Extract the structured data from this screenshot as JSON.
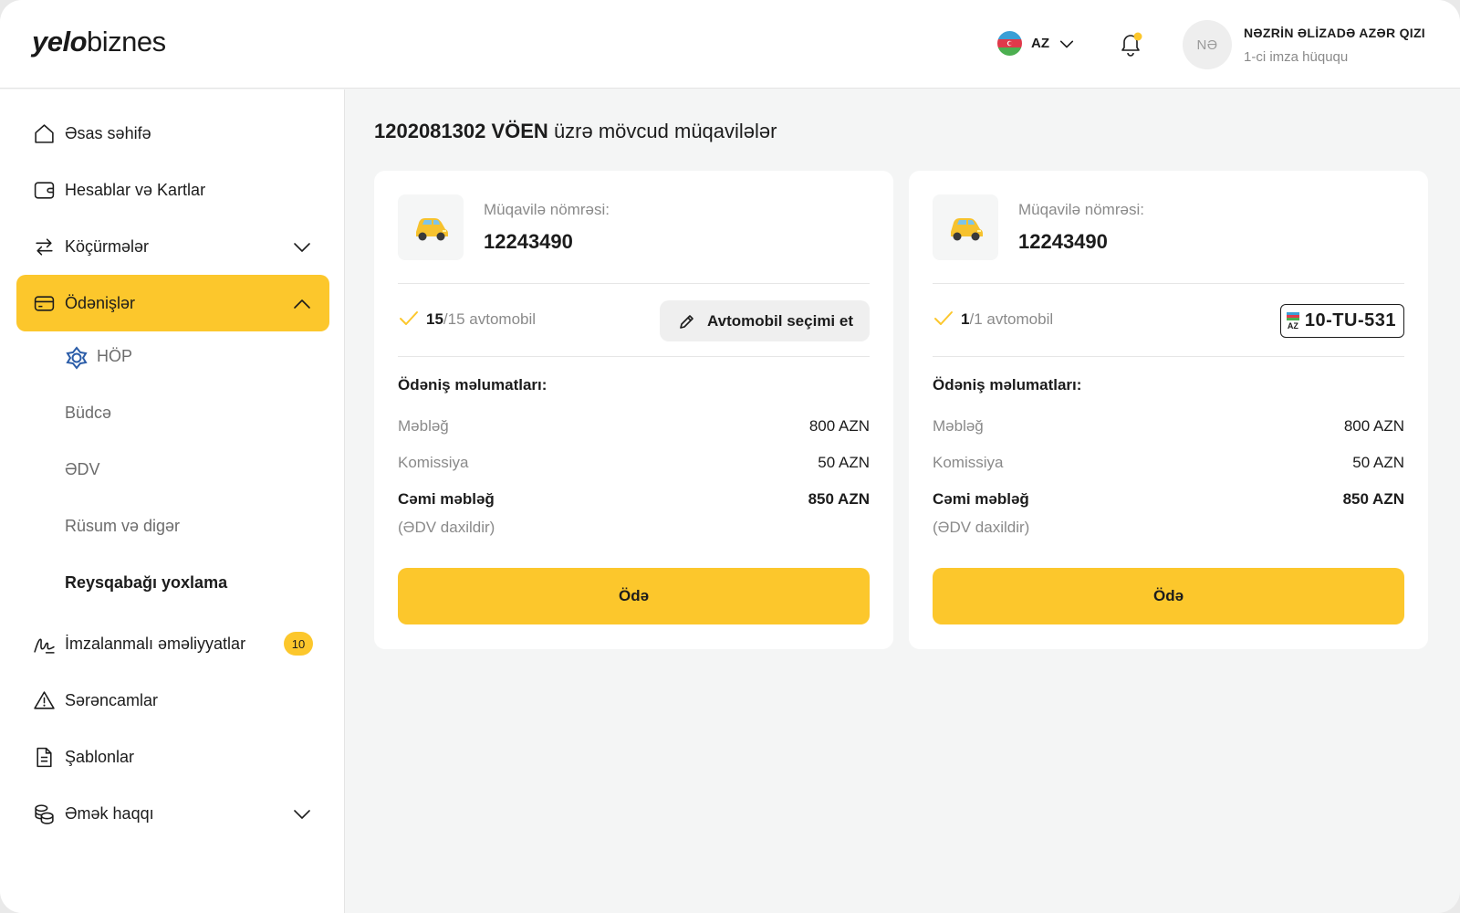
{
  "header": {
    "logo_bold": "yelo",
    "logo_rest": "biznes",
    "language": "AZ",
    "user_initials": "NƏ",
    "user_name": "NƏZRİN ƏLİZADƏ AZƏR QIZI",
    "user_role": "1-ci imza hüququ"
  },
  "sidebar": {
    "items": [
      {
        "label": "Əsas səhifə",
        "icon": "home-icon"
      },
      {
        "label": "Hesablar və Kartlar",
        "icon": "wallet-icon"
      },
      {
        "label": "Köçürmələr",
        "icon": "transfer-icon"
      },
      {
        "label": "Ödənişlər",
        "icon": "card-icon"
      },
      {
        "label": "İmzalanmalı əməliyyatlar",
        "icon": "signature-icon",
        "badge": "10"
      },
      {
        "label": "Sərəncamlar",
        "icon": "warning-icon"
      },
      {
        "label": "Şablonlar",
        "icon": "document-icon"
      },
      {
        "label": "Əmək haqqı",
        "icon": "coins-icon"
      }
    ],
    "sub_items": [
      "HÖP",
      "Büdcə",
      "ƏDV",
      "Rüsum və digər",
      "Reysqabağı yoxlama"
    ]
  },
  "main": {
    "title_bold": "1202081302 VÖEN",
    "title_rest": " üzrə mövcud müqavilələr",
    "cards": [
      {
        "contract_label": "Müqavilə nömrəsi:",
        "contract_number": "12243490",
        "count_bold": "15",
        "count_rest": "/15 avtomobil",
        "action_label": "Avtomobil seçimi et",
        "section_title": "Ödəniş məlumatları:",
        "amount_label": "Məbləğ",
        "amount_value": "800 AZN",
        "fee_label": "Komissiya",
        "fee_value": "50 AZN",
        "total_label": "Cəmi məbləğ",
        "total_value": "850 AZN",
        "vat_note": "(ƏDV daxildir)",
        "pay_label": "Ödə"
      },
      {
        "contract_label": "Müqavilə nömrəsi:",
        "contract_number": "12243490",
        "count_bold": "1",
        "count_rest": "/1 avtomobil",
        "plate_country": "AZ",
        "plate_number": "10-TU-531",
        "section_title": "Ödəniş məlumatları:",
        "amount_label": "Məbləğ",
        "amount_value": "800 AZN",
        "fee_label": "Komissiya",
        "fee_value": "50 AZN",
        "total_label": "Cəmi məbləğ",
        "total_value": "850 AZN",
        "vat_note": "(ƏDV daxildir)",
        "pay_label": "Ödə"
      }
    ]
  },
  "colors": {
    "accent": "#fcc72c",
    "text": "#1c1c1c",
    "muted": "#8a8a8a",
    "background": "#f4f5f5"
  }
}
